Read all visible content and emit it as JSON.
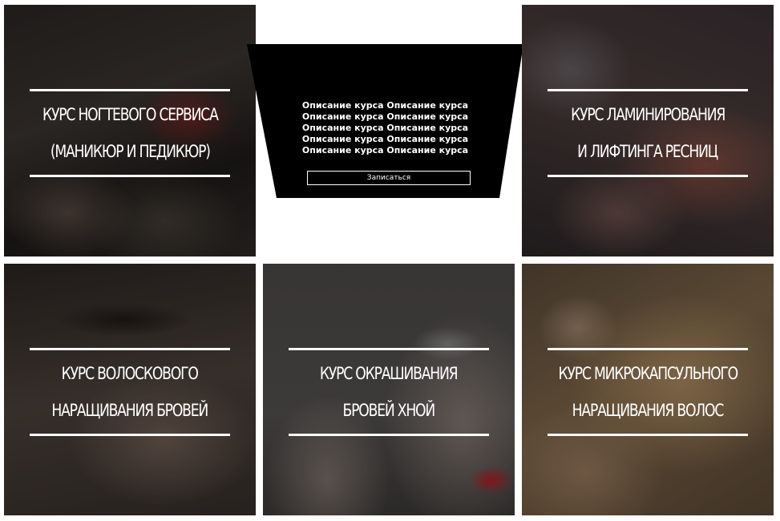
{
  "courses": [
    {
      "line1": "КУРС НОГТЕВОГО СЕРВИСА",
      "line2": "(МАНИКЮР И ПЕДИКЮР)"
    },
    {
      "line1": "КУРС ЛАМИНИРОВАНИЯ",
      "line2": "И ЛИФТИНГА РЕСНИЦ"
    },
    {
      "line1": "КУРС ВОЛОСКОВОГО",
      "line2": "НАРАЩИВАНИЯ БРОВЕЙ"
    },
    {
      "line1": "КУРС ОКРАШИВАНИЯ",
      "line2": "БРОВЕЙ ХНОЙ"
    },
    {
      "line1": "КУРС МИКРОКАПСУЛЬНОГО",
      "line2": "НАРАЩИВАНИЯ ВОЛОС"
    }
  ],
  "description_panel": {
    "lines": [
      "Описание курса Описание курса",
      "Описание курса Описание курса",
      "Описание курса Описание курса",
      "Описание курса Описание курса",
      "Описание курса Описание курса"
    ],
    "button_label": "Записаться"
  },
  "colors": {
    "panel_bg": "#000000",
    "caption_text": "#ffffff",
    "page_bg": "#ffffff"
  }
}
